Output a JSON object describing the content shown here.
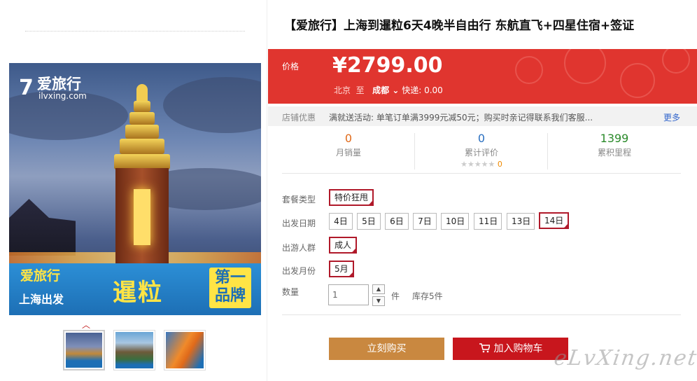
{
  "product": {
    "title": "【爱旅行】上海到暹粒6天4晚半自由行 东航直飞+四星住宿+签证"
  },
  "gallery": {
    "logo_name": "爱旅行",
    "logo_url": "ilvxing.com",
    "banner_line1": "爱旅行",
    "banner_line2": "上海出发",
    "banner_city": "暹粒",
    "banner_badge": "第一品牌",
    "thumbnails": [
      "thumb-1",
      "thumb-2",
      "thumb-3"
    ]
  },
  "price": {
    "label": "价格",
    "value": "¥2799.00",
    "from_city": "北京",
    "to_text": "至",
    "dest_city": "成都",
    "shipping": "快递: 0.00"
  },
  "promo": {
    "label": "店铺优惠",
    "text": "满就送活动: 单笔订单满3999元减50元；购买时亲记得联系我们客服...",
    "more": "更多"
  },
  "stats": [
    {
      "value": "0",
      "label": "月销量"
    },
    {
      "value": "0",
      "label": "累计评价",
      "stars": "★★★★★",
      "rating": "0"
    },
    {
      "value": "1399",
      "label": "累积里程"
    }
  ],
  "options": {
    "package_label": "套餐类型",
    "package_values": [
      "特价狂甩"
    ],
    "date_label": "出发日期",
    "date_values": [
      "4日",
      "5日",
      "6日",
      "7日",
      "10日",
      "11日",
      "13日",
      "14日"
    ],
    "date_selected": "14日",
    "people_label": "出游人群",
    "people_values": [
      "成人"
    ],
    "month_label": "出发月份",
    "month_values": [
      "5月"
    ],
    "qty_label": "数量",
    "qty_value": "1",
    "unit": "件",
    "stock": "库存5件"
  },
  "buttons": {
    "buy_now": "立刻购买",
    "add_cart": "加入购物车"
  },
  "watermark": "eLvXing.net",
  "colors": {
    "price_bg": "#e0352f",
    "buy_btn": "#c98840",
    "cart_btn": "#c8161d",
    "selected_border": "#b0192a"
  }
}
